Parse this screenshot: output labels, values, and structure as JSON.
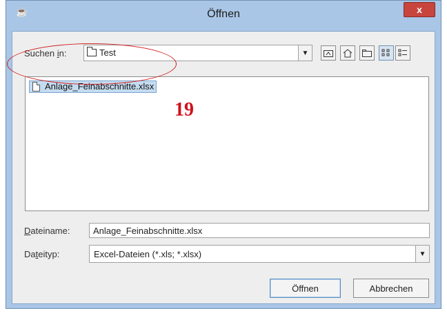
{
  "window": {
    "title": "Öffnen",
    "close_label": "x",
    "app_icon": "java-cup-icon"
  },
  "look_in": {
    "label_prefix": "Suchen ",
    "label_mnemonic": "i",
    "label_suffix": "n:",
    "value": "Test"
  },
  "toolbar": {
    "icons": [
      "up-one-level-icon",
      "home-icon",
      "new-folder-icon",
      "list-view-icon",
      "details-view-icon"
    ]
  },
  "files": [
    {
      "name": "Anlage_Feinabschnitte.xlsx",
      "selected": true
    }
  ],
  "annotation": {
    "number": "19",
    "color": "#d0111d"
  },
  "filename": {
    "label_mnemonic": "D",
    "label_rest": "ateiname:",
    "value": "Anlage_Feinabschnitte.xlsx"
  },
  "filetype": {
    "label_prefix": "Da",
    "label_mnemonic": "t",
    "label_rest": "eityp:",
    "value": "Excel-Dateien (*.xls; *.xlsx)"
  },
  "buttons": {
    "open": "Öffnen",
    "cancel": "Abbrechen"
  }
}
